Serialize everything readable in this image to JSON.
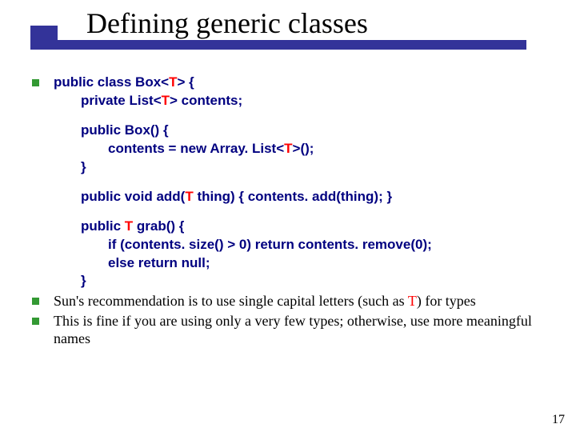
{
  "title": "Defining generic classes",
  "page_number": "17",
  "code": {
    "line1a": "public class Box<",
    "line1b": "T",
    "line1c": "> {",
    "line2a": "private List<",
    "line2b": "T",
    "line2c": "> contents;",
    "line3": "public Box() {",
    "line4a": "contents = new Array. List<",
    "line4b": "T",
    "line4c": ">();",
    "line5": "}",
    "line6a": "public void add(",
    "line6b": "T",
    "line6c": " thing) { contents. add(thing); }",
    "line7a": "public ",
    "line7b": "T",
    "line7c": " grab() {",
    "line8": "if (contents. size() > 0) return contents. remove(0);",
    "line9": "else return null;",
    "line10": "}"
  },
  "bullets": {
    "b2a": "Sun's recommendation is to use single capital letters (such as ",
    "b2b": "T",
    "b2c": ") for types",
    "b3": "This is fine if you are using only a very few types; otherwise, use more meaningful names"
  }
}
